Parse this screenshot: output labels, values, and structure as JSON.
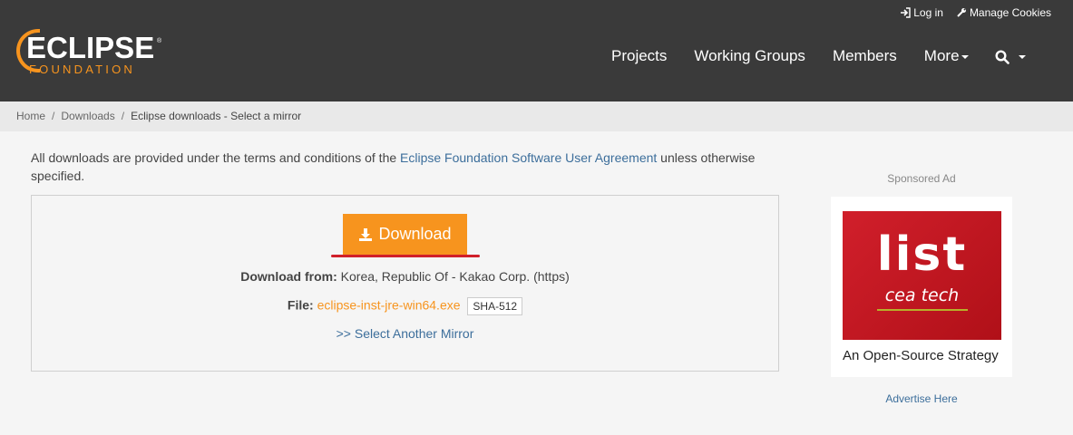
{
  "logo": {
    "word": "ECLIPSE",
    "sub": "FOUNDATION",
    "reg": "®"
  },
  "toplinks": {
    "login": "Log in",
    "cookies": "Manage Cookies"
  },
  "nav": {
    "projects": "Projects",
    "working_groups": "Working Groups",
    "members": "Members",
    "more": "More"
  },
  "breadcrumb": {
    "home": "Home",
    "downloads": "Downloads",
    "current": "Eclipse downloads - Select a mirror",
    "sep": "/"
  },
  "notice": {
    "prefix": "All downloads are provided under the terms and conditions of the ",
    "link": "Eclipse Foundation Software User Agreement",
    "suffix": " unless otherwise specified."
  },
  "download": {
    "button": "Download",
    "from_label": "Download from:",
    "from_value": " Korea, Republic Of - Kakao Corp. (https)",
    "file_label": "File:",
    "file_name": "eclipse-inst-jre-win64.exe",
    "sha": "SHA-512",
    "mirror_link": ">> Select Another Mirror"
  },
  "ad": {
    "sponsored": "Sponsored Ad",
    "logo_text": "list",
    "brand": "cea tech",
    "caption": "An Open-Source Strategy",
    "advertise": "Advertise Here"
  },
  "colors": {
    "header": "#3a3a3a",
    "accent": "#f7941e",
    "link": "#3c6e9b"
  }
}
